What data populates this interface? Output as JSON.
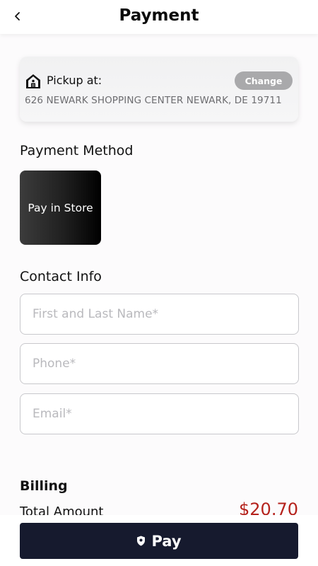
{
  "header": {
    "title": "Payment"
  },
  "pickup": {
    "label": "Pickup at:",
    "change_label": "Change",
    "address": "626 NEWARK SHOPPING CENTER NEWARK, DE 19711"
  },
  "payment_method": {
    "title": "Payment Method",
    "option_label": "Pay in Store"
  },
  "contact": {
    "title": "Contact Info",
    "name_placeholder": "First and Last Name*",
    "phone_placeholder": "Phone*",
    "email_placeholder": "Email*"
  },
  "billing": {
    "title": "Billing",
    "total_label": "Total Amount",
    "total_value": "$20.70"
  },
  "pay_button": {
    "label": "Pay"
  },
  "colors": {
    "accent_price": "#b5221c",
    "pay_button_bg": "#161a2e",
    "change_button_bg": "#a9a9ab"
  },
  "icons": {
    "back": "chevron-left-icon",
    "pickup": "house-icon",
    "pay": "shield-icon"
  }
}
